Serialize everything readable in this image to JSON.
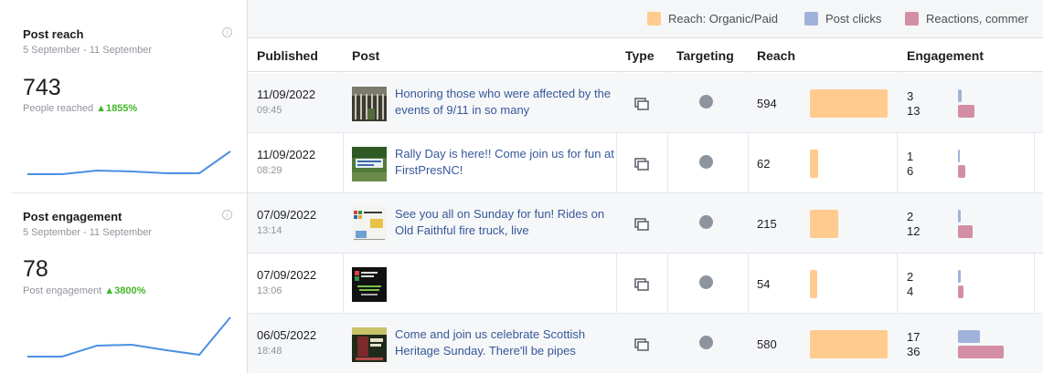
{
  "summary": {
    "reach": {
      "title": "Post reach",
      "range": "5 September - 11 September",
      "value": "743",
      "label": "People reached",
      "delta": "▲1855%"
    },
    "engagement": {
      "title": "Post engagement",
      "range": "5 September - 11 September",
      "value": "78",
      "label": "Post engagement",
      "delta": "▲3800%"
    },
    "info_icon": "i"
  },
  "legend": [
    {
      "label": "Reach: Organic/Paid",
      "color": "#ffcb8e"
    },
    {
      "label": "Post clicks",
      "color": "#a1b2da"
    },
    {
      "label": "Reactions, commer",
      "color": "#d38ea5"
    }
  ],
  "columns": {
    "published": "Published",
    "post": "Post",
    "type": "Type",
    "targeting": "Targeting",
    "reach": "Reach",
    "engagement": "Engagement"
  },
  "colors": {
    "reach_bar": "#ffcb8e",
    "clicks_bar": "#a1b2da",
    "reactions_bar": "#d38ea5",
    "link": "#365899",
    "delta": "#42b72a",
    "sparkline": "#4a90e2"
  },
  "rows": [
    {
      "date": "11/09/2022",
      "time": "09:45",
      "text": "Honoring those who were affected by the events of 9/11 in so many",
      "reach": "594",
      "clicks": "3",
      "reactions": "13",
      "thumb": "memorial-photo"
    },
    {
      "date": "11/09/2022",
      "time": "08:29",
      "text": "Rally Day is here!! Come join us for fun at FirstPresNC!",
      "reach": "62",
      "clicks": "1",
      "reactions": "6",
      "thumb": "banner-photo"
    },
    {
      "date": "07/09/2022",
      "time": "13:14",
      "text": "See you all on Sunday for fun! Rides on Old Faithful fire truck, live",
      "reach": "215",
      "clicks": "2",
      "reactions": "12",
      "thumb": "flyer-image"
    },
    {
      "date": "07/09/2022",
      "time": "13:06",
      "text": "",
      "reach": "54",
      "clicks": "2",
      "reactions": "4",
      "thumb": "dark-flyer-image"
    },
    {
      "date": "06/05/2022",
      "time": "18:48",
      "text": "Come and join us celebrate Scottish Heritage Sunday. There'll be pipes",
      "reach": "580",
      "clicks": "17",
      "reactions": "36",
      "thumb": "scottish-poster"
    }
  ],
  "icons": {
    "type": "multi-photo-icon",
    "targeting": "globe-icon"
  }
}
